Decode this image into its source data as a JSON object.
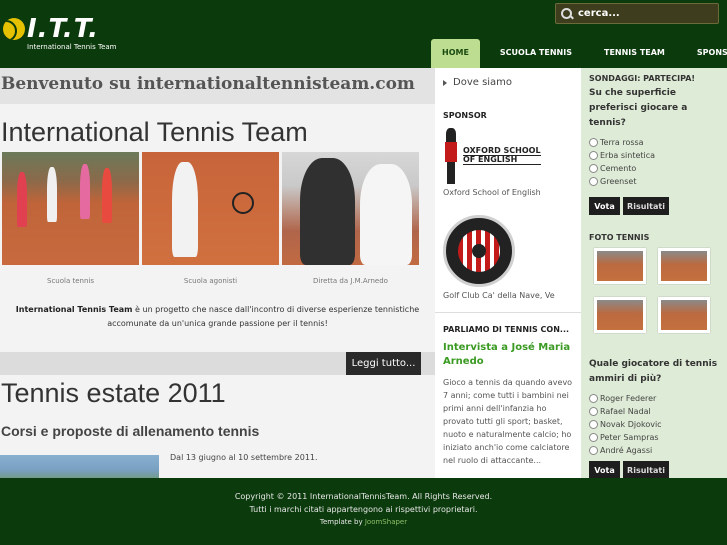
{
  "header": {
    "logo_text": "I.T.T.",
    "logo_subtitle": "International Tennis Team",
    "search_placeholder": "cerca...",
    "nav": [
      "HOME",
      "SCUOLA TENNIS",
      "TENNIS TEAM",
      "SPONSOR"
    ]
  },
  "main": {
    "welcome": "Benvenuto su internationaltennisteam.com",
    "title": "International Tennis Team",
    "captions": [
      "Scuola tennis",
      "Scuola agonisti",
      "Diretta da J.M.Arnedo"
    ],
    "intro_bold": "International Tennis Team",
    "intro_rest": " è un progetto che nasce dall'incontro di diverse esperienze tennistiche accomunate da un'unica grande passione per il tennis!",
    "read_more": "Leggi tutto...",
    "article_title": "Tennis estate 2011",
    "article_subtitle": "Corsi e proposte di allenamento tennis",
    "article_date": "Dal 13 giugno al 10 settembre 2011."
  },
  "middle": {
    "dove": "Dove siamo",
    "sponsor_title": "SPONSOR",
    "oxford_logo": [
      "OXFORD SCHOOL",
      "OF ENGLISH"
    ],
    "oxford_caption": "Oxford School of English",
    "golf_caption": "Golf Club Ca' della Nave, Ve",
    "parliamo": "PARLIAMO DI TENNIS CON...",
    "intervista": "Intervista a José Maria Arnedo",
    "storia": "Gioco a tennis da quando avevo 7 anni; come tutti i bambini nei primi anni dell'infanzia ho provato tutti gli sport; basket, nuoto e naturalmente calcio; ho iniziato anch'io come calciatore nel ruolo di attaccante..."
  },
  "right": {
    "poll_head": "SONDAGGI: PARTECIPA!",
    "poll1_question": "Su che superficie preferisci giocare a tennis?",
    "poll1_options": [
      "Terra rossa",
      "Erba sintetica",
      "Cemento",
      "Greenset"
    ],
    "vote": "Vota",
    "results": "Risultati",
    "foto_title": "FOTO TENNIS",
    "poll2_question": "Quale giocatore di tennis ammiri di più?",
    "poll2_options": [
      "Roger Federer",
      "Rafael Nadal",
      "Novak Djokovic",
      "Peter Sampras",
      "André Agassi"
    ]
  },
  "footer": {
    "copyright": "Copyright © 2011 InternationalTennisTeam. All Rights Reserved.",
    "trademarks": "Tutti i marchi citati appartengono ai rispettivi proprietari.",
    "template_prefix": "Template by ",
    "template_link": "JoomShaper"
  }
}
